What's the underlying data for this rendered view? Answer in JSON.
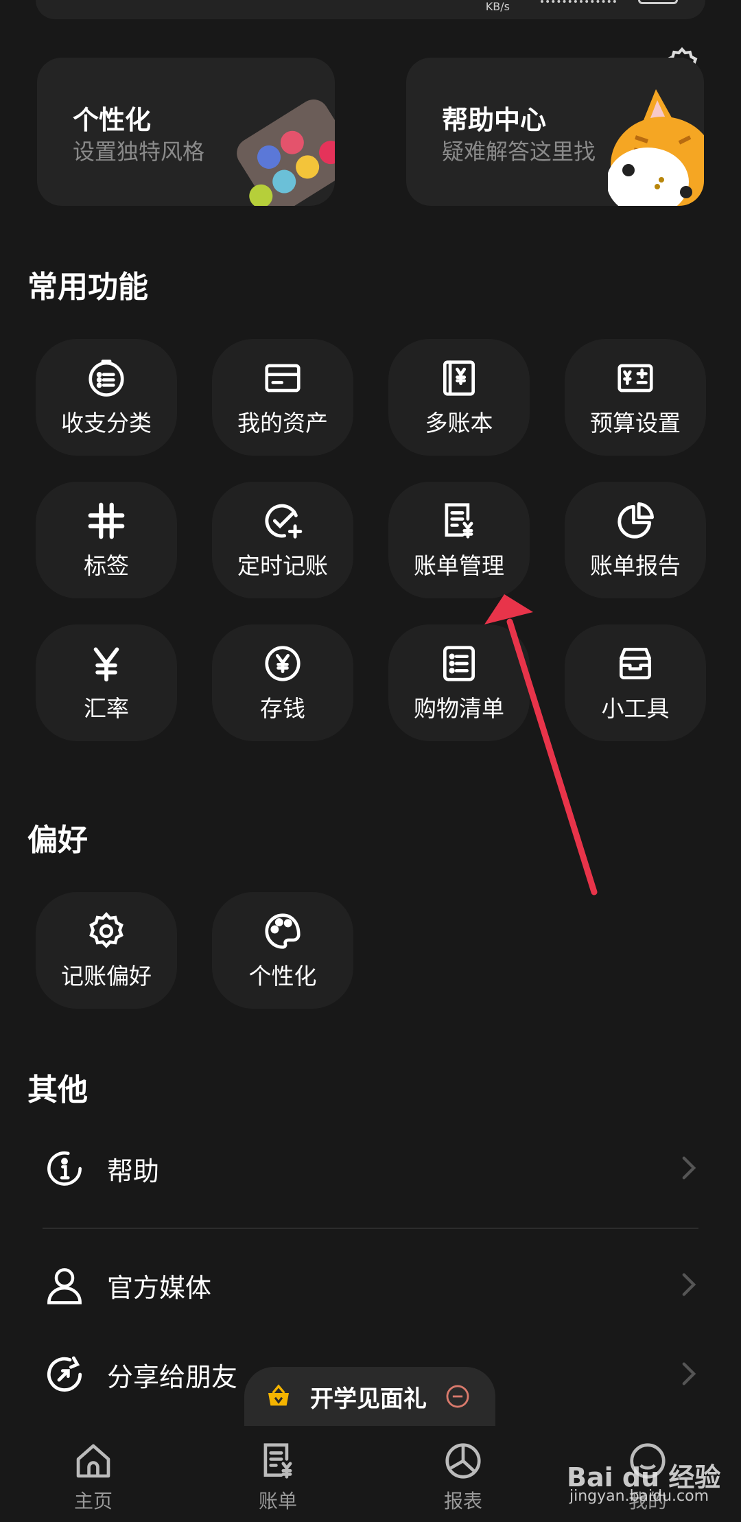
{
  "header_cards": [
    {
      "title": "个性化",
      "subtitle": "设置独特风格"
    },
    {
      "title": "帮助中心",
      "subtitle": "疑难解答这里找"
    }
  ],
  "sections": {
    "common": "常用功能",
    "preferences": "偏好",
    "other": "其他"
  },
  "common_functions": [
    {
      "label": "收支分类",
      "icon": "category-list-icon"
    },
    {
      "label": "我的资产",
      "icon": "card-icon"
    },
    {
      "label": "多账本",
      "icon": "ledger-book-icon"
    },
    {
      "label": "预算设置",
      "icon": "budget-icon"
    },
    {
      "label": "标签",
      "icon": "hashtag-icon"
    },
    {
      "label": "定时记账",
      "icon": "scheduled-check-icon"
    },
    {
      "label": "账单管理",
      "icon": "bill-manage-icon"
    },
    {
      "label": "账单报告",
      "icon": "pie-report-icon"
    },
    {
      "label": "汇率",
      "icon": "yen-icon"
    },
    {
      "label": "存钱",
      "icon": "coin-icon"
    },
    {
      "label": "购物清单",
      "icon": "list-icon"
    },
    {
      "label": "小工具",
      "icon": "toolbox-icon"
    }
  ],
  "preferences": [
    {
      "label": "记账偏好",
      "icon": "gear-icon"
    },
    {
      "label": "个性化",
      "icon": "palette-icon"
    }
  ],
  "other_rows": [
    {
      "label": "帮助",
      "icon": "info-icon"
    },
    {
      "label": "官方媒体",
      "icon": "person-icon"
    },
    {
      "label": "分享给朋友",
      "icon": "share-icon"
    }
  ],
  "promo": {
    "label": "开学见面礼"
  },
  "tabs": [
    {
      "label": "主页",
      "icon": "home-icon"
    },
    {
      "label": "账单",
      "icon": "bill-icon"
    },
    {
      "label": "报表",
      "icon": "report-icon"
    },
    {
      "label": "我的",
      "icon": "profile-icon"
    }
  ],
  "watermark": {
    "brand": "Bai du 经验",
    "url": "jingyan.baidu.com"
  },
  "colors": {
    "background": "#181818",
    "tile": "#212121",
    "annotation_arrow": "#e8344a",
    "accent": "#ff6b35"
  }
}
